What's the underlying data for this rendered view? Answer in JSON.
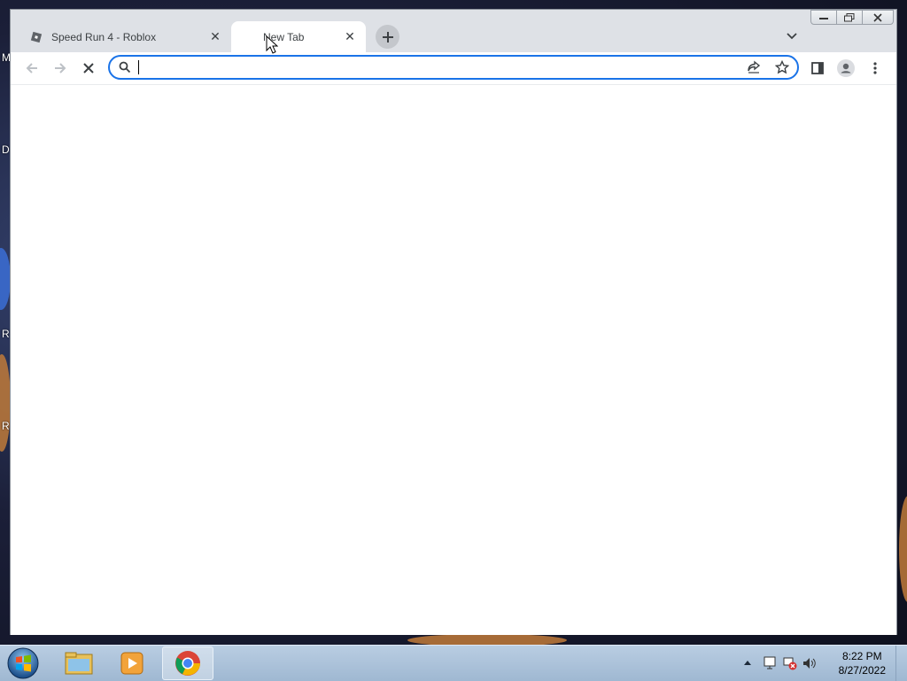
{
  "desktop": {
    "icon_labels": [
      "M",
      "D",
      "R",
      "R"
    ]
  },
  "browser": {
    "tabs": [
      {
        "title": "Speed Run 4 - Roblox",
        "favicon": "roblox-icon",
        "active": false
      },
      {
        "title": "New Tab",
        "favicon": "loading-icon",
        "active": true
      }
    ],
    "omnibox": {
      "value": "",
      "placeholder": ""
    },
    "accent_color": "#1a73e8"
  },
  "taskbar": {
    "apps": [
      {
        "name": "file-explorer-icon"
      },
      {
        "name": "media-player-icon"
      },
      {
        "name": "chrome-icon"
      }
    ],
    "clock": {
      "time": "8:22 PM",
      "date": "8/27/2022"
    }
  }
}
